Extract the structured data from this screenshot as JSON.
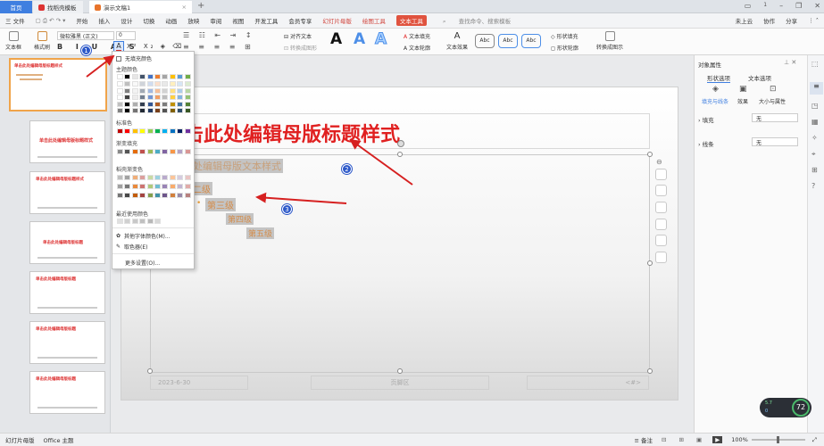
{
  "tabs": {
    "home": "首页",
    "template": "找稻壳模板",
    "doc": "演示文稿1",
    "add": "+"
  },
  "window": {
    "user_count": "1"
  },
  "menu": {
    "file": "三 文件",
    "items": [
      "开始",
      "插入",
      "设计",
      "切换",
      "动画",
      "放映",
      "审阅",
      "视图",
      "开发工具",
      "会员专享"
    ],
    "ctx_tabs": [
      "幻灯片母版",
      "绘图工具",
      "文本工具"
    ],
    "search": "查找命令、搜索模板",
    "right": [
      "未上云",
      "协作",
      "分享"
    ]
  },
  "ribbon": {
    "text_box": "文本框",
    "format_brush": "格式刷",
    "font_name": "微软雅黑 (正文)",
    "font_size": "0",
    "align_text": "对齐文本",
    "convert_smartart": "转换成图形",
    "text_fill": "文本填充",
    "text_outline": "文本轮廓",
    "text_effect": "文本效果",
    "shape_fill": "形状填充",
    "shape_outline": "形状轮廓",
    "convert_image": "转换成图示",
    "style_samples": [
      "Abc",
      "Abc",
      "Abc"
    ]
  },
  "dropdown": {
    "no_fill": "无填充颜色",
    "theme_colors": "主题颜色",
    "standard": "标准色",
    "gradient": "渐变填充",
    "stripe": "稻壳渐变色",
    "recent": "最近使用颜色",
    "more_colors": "其他字体颜色(M)...",
    "eyedropper": "取色器(E)",
    "more_settings": "更多设置(O)...",
    "theme_top": [
      "#ffffff",
      "#000000",
      "#e7e6e6",
      "#44546a",
      "#4472c4",
      "#ed7d31",
      "#a5a5a5",
      "#ffc000",
      "#5b9bd5",
      "#70ad47"
    ],
    "standard_colors": [
      "#c00000",
      "#ff0000",
      "#ffc000",
      "#ffff00",
      "#92d050",
      "#00b050",
      "#00b0f0",
      "#0070c0",
      "#002060",
      "#7030a0"
    ],
    "gradient_colors": [
      "#888888",
      "#555555",
      "#e46c0a",
      "#c0504d",
      "#9bbb59",
      "#4bacc6",
      "#8064a2",
      "#f79646",
      "#b3a2c7",
      "#d99694"
    ],
    "recent_colors": [
      "#e0e0e0",
      "#d0d0d0",
      "#c8c8c8",
      "#c0c0c0",
      "#b8b8b8",
      "#d8d8d8"
    ]
  },
  "slide": {
    "title": "击此处编辑母版标题样式",
    "l1": "此处编辑母版文本样式",
    "l2": "二级",
    "l3": "第三级",
    "l4": "第四级",
    "l5": "第五级",
    "date": "2023-6-30",
    "footer": "页脚区",
    "num": "<#>"
  },
  "markers": [
    "1",
    "2",
    "3"
  ],
  "thumbs": [
    {
      "num": "1",
      "title": "单击此处编辑母版标题样式"
    },
    {
      "num": "",
      "title": "单击此处编辑母版标题样式"
    },
    {
      "num": "",
      "title": "单击此处编辑母版标题样式"
    },
    {
      "num": "",
      "title": "单击此处编辑母版标题"
    },
    {
      "num": "",
      "title": "单击此处编辑母版标题"
    },
    {
      "num": "",
      "title": "单击此处编辑母版标题"
    },
    {
      "num": "",
      "title": "单击此处编辑母版标题"
    }
  ],
  "rightpane": {
    "title": "对象属性",
    "tabs": [
      "形状选项",
      "文本选项"
    ],
    "subtabs": [
      "填充与线条",
      "效果",
      "大小与属性"
    ],
    "fill": "填充",
    "fill_val": "无",
    "line": "线条",
    "line_val": "无"
  },
  "status": {
    "mode": "幻灯片母版",
    "theme": "Office 主题",
    "note": "备注",
    "zoom": "100%",
    "speed": "72",
    "up": "5.7",
    "down": "0"
  }
}
